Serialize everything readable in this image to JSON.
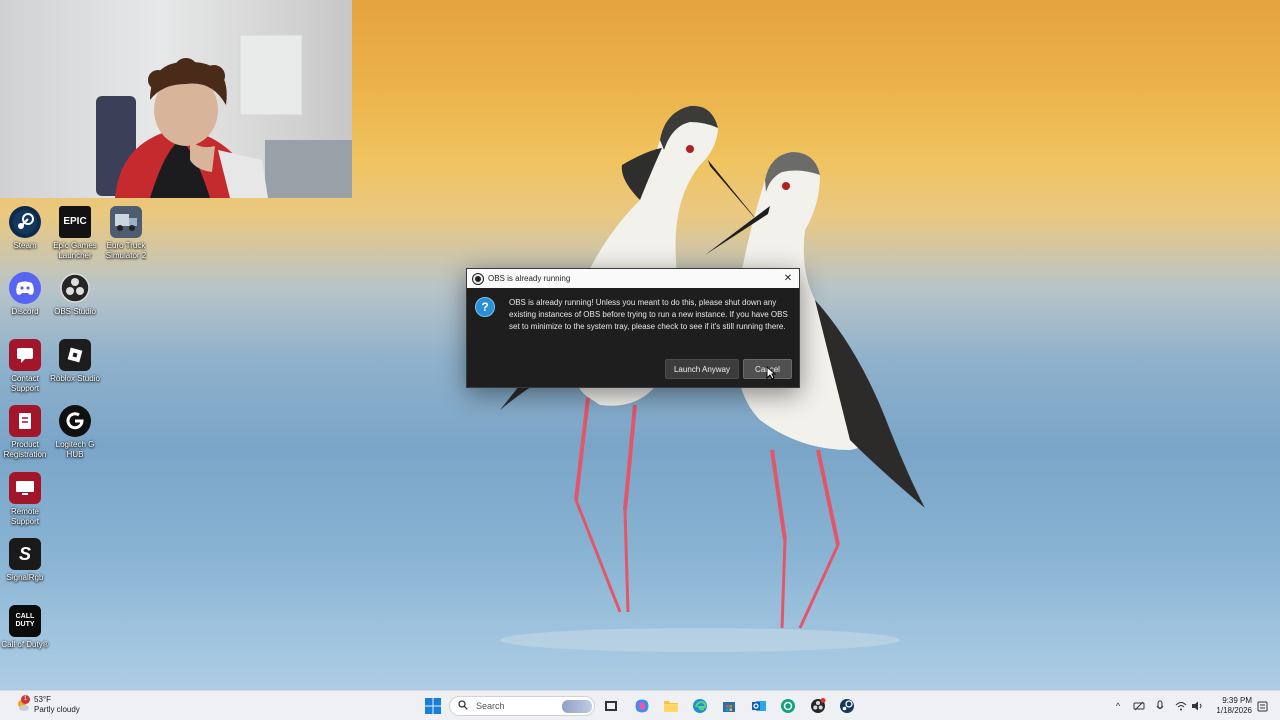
{
  "desktop": {
    "icons": [
      {
        "label": "Steam",
        "icon": "steam-icon"
      },
      {
        "label": "Epic Games Launcher",
        "icon": "epic-games-icon"
      },
      {
        "label": "Euro Truck Simulator 2",
        "icon": "truck-icon"
      },
      {
        "label": "Discord",
        "icon": "discord-icon"
      },
      {
        "label": "OBS Studio",
        "icon": "obs-icon"
      },
      {
        "label": "Contact Support",
        "icon": "contact-support-icon"
      },
      {
        "label": "Roblox Studio",
        "icon": "roblox-icon"
      },
      {
        "label": "Product Registration",
        "icon": "product-registration-icon"
      },
      {
        "label": "Logitech G HUB",
        "icon": "logitech-icon"
      },
      {
        "label": "Remote Support",
        "icon": "remote-support-icon"
      },
      {
        "label": "SignalRgb",
        "icon": "signalrgb-icon"
      },
      {
        "label": "Call of Duty®",
        "icon": "call-of-duty-icon"
      }
    ]
  },
  "dialog": {
    "title": "OBS is already running",
    "message": "OBS is already running! Unless you meant to do this, please shut down any existing instances of OBS before trying to run a new instance. If you have OBS set to minimize to the system tray, please check to see if it's still running there.",
    "launch_label": "Launch Anyway",
    "cancel_label": "Cancel",
    "close_glyph": "✕",
    "icon_glyph": "?"
  },
  "taskbar": {
    "weather_temp": "53°F",
    "weather_desc": "Partly cloudy",
    "weather_badge": "1",
    "search_placeholder": "Search",
    "time": "9:39 PM",
    "date": "1/18/2026"
  },
  "colors": {
    "dialog_bg": "#1e1e1e",
    "accent_blue": "#2b8fd6",
    "taskbar_bg": "#eef0f3"
  }
}
